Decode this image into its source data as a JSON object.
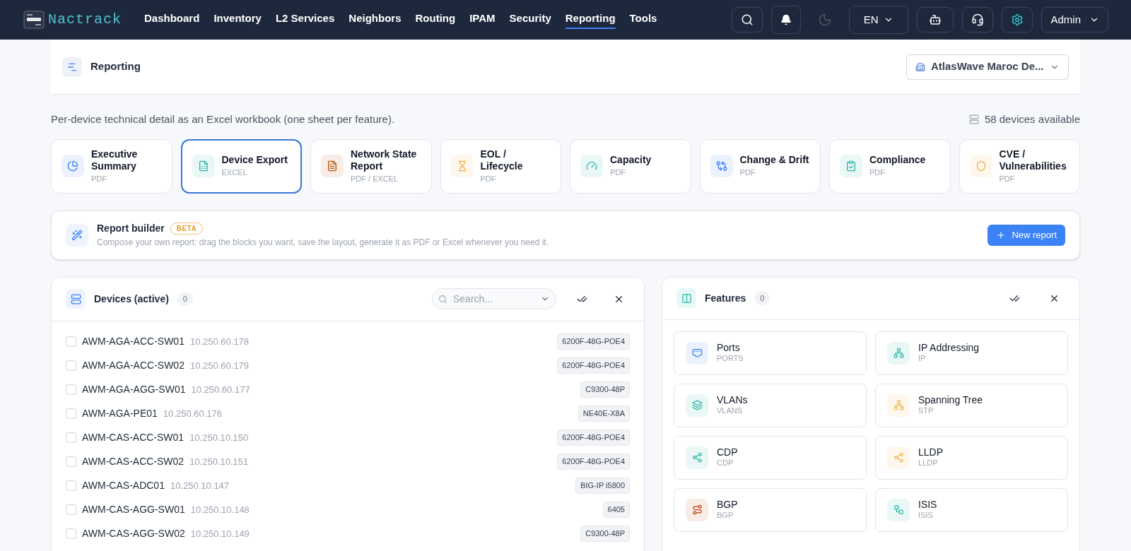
{
  "nav": {
    "logo": "Nactrack",
    "items": [
      {
        "label": "Dashboard",
        "selected": false
      },
      {
        "label": "Inventory",
        "selected": false
      },
      {
        "label": "L2 Services",
        "selected": false
      },
      {
        "label": "Neighbors",
        "selected": false
      },
      {
        "label": "Routing",
        "selected": false
      },
      {
        "label": "IPAM",
        "selected": false
      },
      {
        "label": "Security",
        "selected": false
      },
      {
        "label": "Reporting",
        "selected": true
      },
      {
        "label": "Tools",
        "selected": false
      }
    ],
    "language": "EN",
    "user": "Admin"
  },
  "header": {
    "title": "Reporting",
    "site": "AtlasWave Maroc De..."
  },
  "description": "Per-device technical detail as an Excel workbook (one sheet per feature).",
  "device_count": "58 devices available",
  "report_types": [
    {
      "title": "Executive Summary",
      "format": "PDF",
      "color": "#3b82f6",
      "selected": false
    },
    {
      "title": "Device Export",
      "format": "EXCEL",
      "color": "#2cb5a8",
      "selected": true
    },
    {
      "title": "Network State Report",
      "format": "PDF / EXCEL",
      "color": "#b45309",
      "selected": false
    },
    {
      "title": "EOL / Lifecycle",
      "format": "PDF",
      "color": "#f0b44c",
      "selected": false
    },
    {
      "title": "Capacity",
      "format": "PDF",
      "color": "#2cb5a8",
      "selected": false
    },
    {
      "title": "Change & Drift",
      "format": "PDF",
      "color": "#3b82f6",
      "selected": false
    },
    {
      "title": "Compliance",
      "format": "PDF",
      "color": "#2cb5a8",
      "selected": false
    },
    {
      "title": "CVE / Vulnerabilities",
      "format": "PDF",
      "color": "#f0b44c",
      "selected": false
    }
  ],
  "report_builder": {
    "title": "Report builder",
    "badge": "BETA",
    "description": "Compose your own report: drag the blocks you want, save the layout, generate it as PDF or Excel whenever you need it.",
    "button": "New report"
  },
  "devices": {
    "title": "Devices (active)",
    "count": "0",
    "search_placeholder": "Search...",
    "rows": [
      {
        "name": "AWM-AGA-ACC-SW01",
        "ip": "10.250.60.178",
        "model": "6200F-48G-POE4",
        "checked": false
      },
      {
        "name": "AWM-AGA-ACC-SW02",
        "ip": "10.250.60.179",
        "model": "6200F-48G-POE4",
        "checked": false
      },
      {
        "name": "AWM-AGA-AGG-SW01",
        "ip": "10.250.60.177",
        "model": "C9300-48P",
        "checked": false
      },
      {
        "name": "AWM-AGA-PE01",
        "ip": "10.250.60.176",
        "model": "NE40E-X8A",
        "checked": false
      },
      {
        "name": "AWM-CAS-ACC-SW01",
        "ip": "10.250.10.150",
        "model": "6200F-48G-POE4",
        "checked": false
      },
      {
        "name": "AWM-CAS-ACC-SW02",
        "ip": "10.250.10.151",
        "model": "6200F-48G-POE4",
        "checked": false
      },
      {
        "name": "AWM-CAS-ADC01",
        "ip": "10.250.10.147",
        "model": "BIG-IP i5800",
        "checked": false
      },
      {
        "name": "AWM-CAS-AGG-SW01",
        "ip": "10.250.10.148",
        "model": "6405",
        "checked": false
      },
      {
        "name": "AWM-CAS-AGG-SW02",
        "ip": "10.250.10.149",
        "model": "C9300-48P",
        "checked": false
      }
    ]
  },
  "features": {
    "title": "Features",
    "count": "0",
    "items": [
      {
        "title": "Ports",
        "code": "PORTS",
        "color": "#3b82f6"
      },
      {
        "title": "IP Addressing",
        "code": "IP",
        "color": "#2cb5a8"
      },
      {
        "title": "VLANs",
        "code": "VLANS",
        "color": "#2cb5a8"
      },
      {
        "title": "Spanning Tree",
        "code": "STP",
        "color": "#f0b44c"
      },
      {
        "title": "CDP",
        "code": "CDP",
        "color": "#2cb5a8"
      },
      {
        "title": "LLDP",
        "code": "LLDP",
        "color": "#f0b44c"
      },
      {
        "title": "BGP",
        "code": "BGP",
        "color": "#c2410c"
      },
      {
        "title": "ISIS",
        "code": "ISIS",
        "color": "#2cb5a8"
      }
    ]
  }
}
